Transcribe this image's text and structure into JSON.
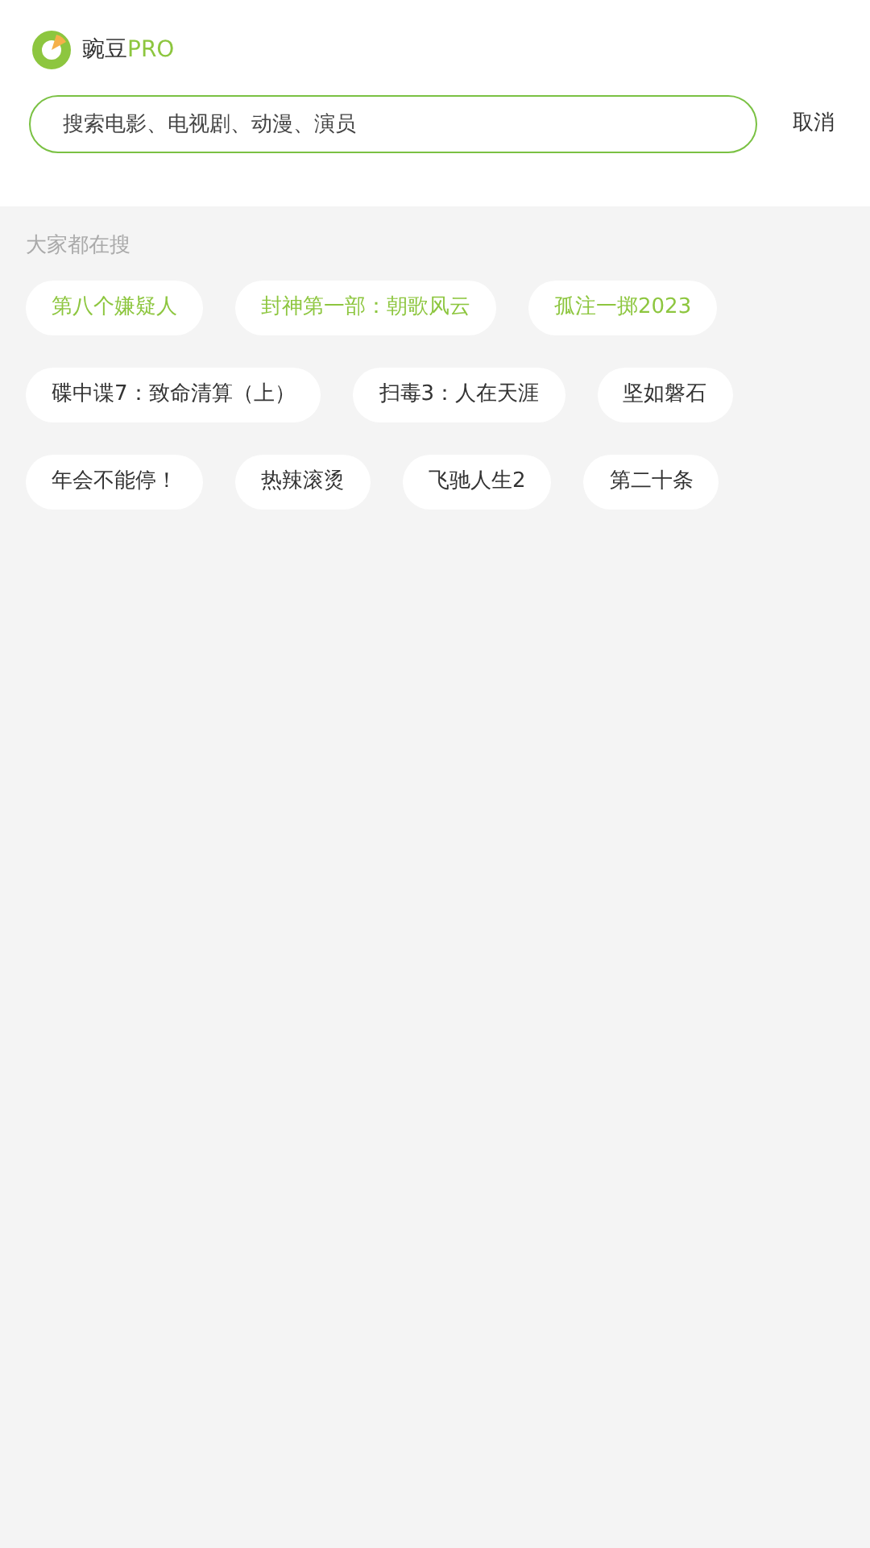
{
  "header": {
    "brand": "豌豆",
    "brand_suffix": "PRO"
  },
  "search": {
    "placeholder": "搜索电影、电视剧、动漫、演员",
    "cancel": "取消"
  },
  "hot_searches": {
    "title": "大家都在搜",
    "tags": [
      {
        "label": "第八个嫌疑人",
        "hot": true
      },
      {
        "label": "封神第一部：朝歌风云",
        "hot": true
      },
      {
        "label": "孤注一掷2023",
        "hot": true
      },
      {
        "label": "碟中谍7：致命清算（上）",
        "hot": false
      },
      {
        "label": "扫毒3：人在天涯",
        "hot": false
      },
      {
        "label": "坚如磐石",
        "hot": false
      },
      {
        "label": "年会不能停！",
        "hot": false
      },
      {
        "label": "热辣滚烫",
        "hot": false
      },
      {
        "label": "飞驰人生2",
        "hot": false
      },
      {
        "label": "第二十条",
        "hot": false
      }
    ]
  }
}
